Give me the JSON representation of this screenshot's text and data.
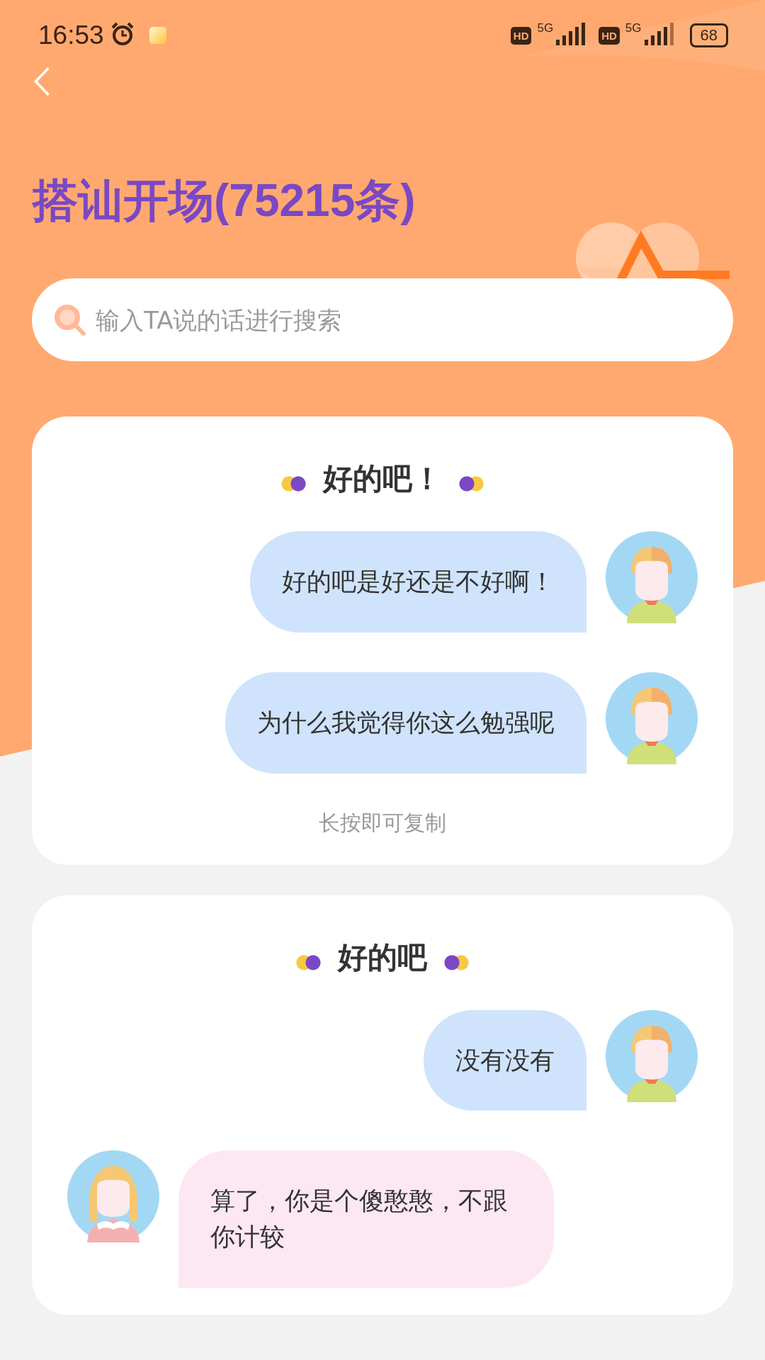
{
  "status_bar": {
    "time": "16:53",
    "sims": [
      {
        "badge": "HD",
        "network": "5G"
      },
      {
        "badge": "HD",
        "network": "5G"
      }
    ],
    "battery": "68"
  },
  "title": "搭讪开场(75215条)",
  "search": {
    "placeholder": "输入TA说的话进行搜索"
  },
  "cards": [
    {
      "title": "好的吧！",
      "messages": [
        {
          "kind": "me",
          "text": "好的吧是好还是不好啊！"
        },
        {
          "kind": "me",
          "text": "为什么我觉得你这么勉强呢"
        }
      ],
      "hint": "长按即可复制"
    },
    {
      "title": "好的吧",
      "messages": [
        {
          "kind": "me",
          "text": "没有没有"
        },
        {
          "kind": "ta",
          "text": "算了，你是个傻憨憨，不跟你计较"
        }
      ]
    }
  ]
}
